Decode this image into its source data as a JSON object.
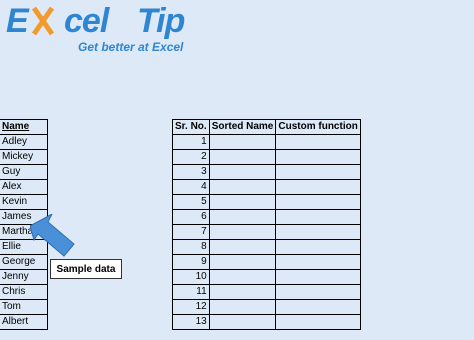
{
  "logo": {
    "brand_e": "E",
    "brand_rest": "cel",
    "brand_tip": "Tip",
    "tagline": "Get better at Excel"
  },
  "names": {
    "header": "Name",
    "items": [
      "Adley",
      "Mickey",
      "Guy",
      "Alex",
      "Kevin",
      "James",
      "Martha",
      "Ellie",
      "George",
      "Jenny",
      "Chris",
      "Tom",
      "Albert"
    ]
  },
  "grid": {
    "headers": [
      "Sr. No.",
      "Sorted Name",
      "Custom function"
    ],
    "rows": [
      {
        "sr": "1",
        "sorted": "",
        "custom": ""
      },
      {
        "sr": "2",
        "sorted": "",
        "custom": ""
      },
      {
        "sr": "3",
        "sorted": "",
        "custom": ""
      },
      {
        "sr": "4",
        "sorted": "",
        "custom": ""
      },
      {
        "sr": "5",
        "sorted": "",
        "custom": ""
      },
      {
        "sr": "6",
        "sorted": "",
        "custom": ""
      },
      {
        "sr": "7",
        "sorted": "",
        "custom": ""
      },
      {
        "sr": "8",
        "sorted": "",
        "custom": ""
      },
      {
        "sr": "9",
        "sorted": "",
        "custom": ""
      },
      {
        "sr": "10",
        "sorted": "",
        "custom": ""
      },
      {
        "sr": "11",
        "sorted": "",
        "custom": ""
      },
      {
        "sr": "12",
        "sorted": "",
        "custom": ""
      },
      {
        "sr": "13",
        "sorted": "",
        "custom": ""
      }
    ]
  },
  "callout": {
    "label": "Sample data"
  },
  "colors": {
    "background": "#dde9f6",
    "brand": "#2e86d2",
    "arrow": "#4a90d9"
  }
}
